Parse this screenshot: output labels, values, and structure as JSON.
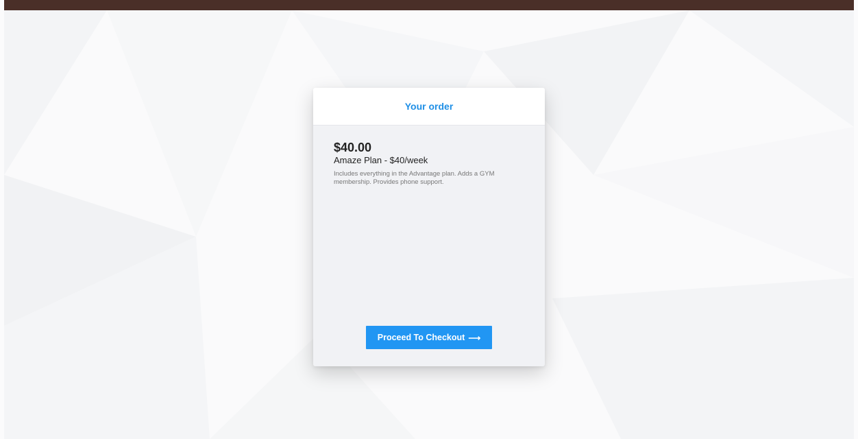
{
  "order": {
    "title": "Your order",
    "price": "$40.00",
    "plan_name": "Amaze Plan - $40/week",
    "description": "Includes everything in the Advantage plan. Adds a GYM membership. Provides phone support."
  },
  "checkout": {
    "label": "Proceed To Checkout",
    "arrow": "⟶"
  },
  "colors": {
    "accent": "#2196f3",
    "title": "#1f8fe6",
    "top_bar": "#4a2f28"
  }
}
